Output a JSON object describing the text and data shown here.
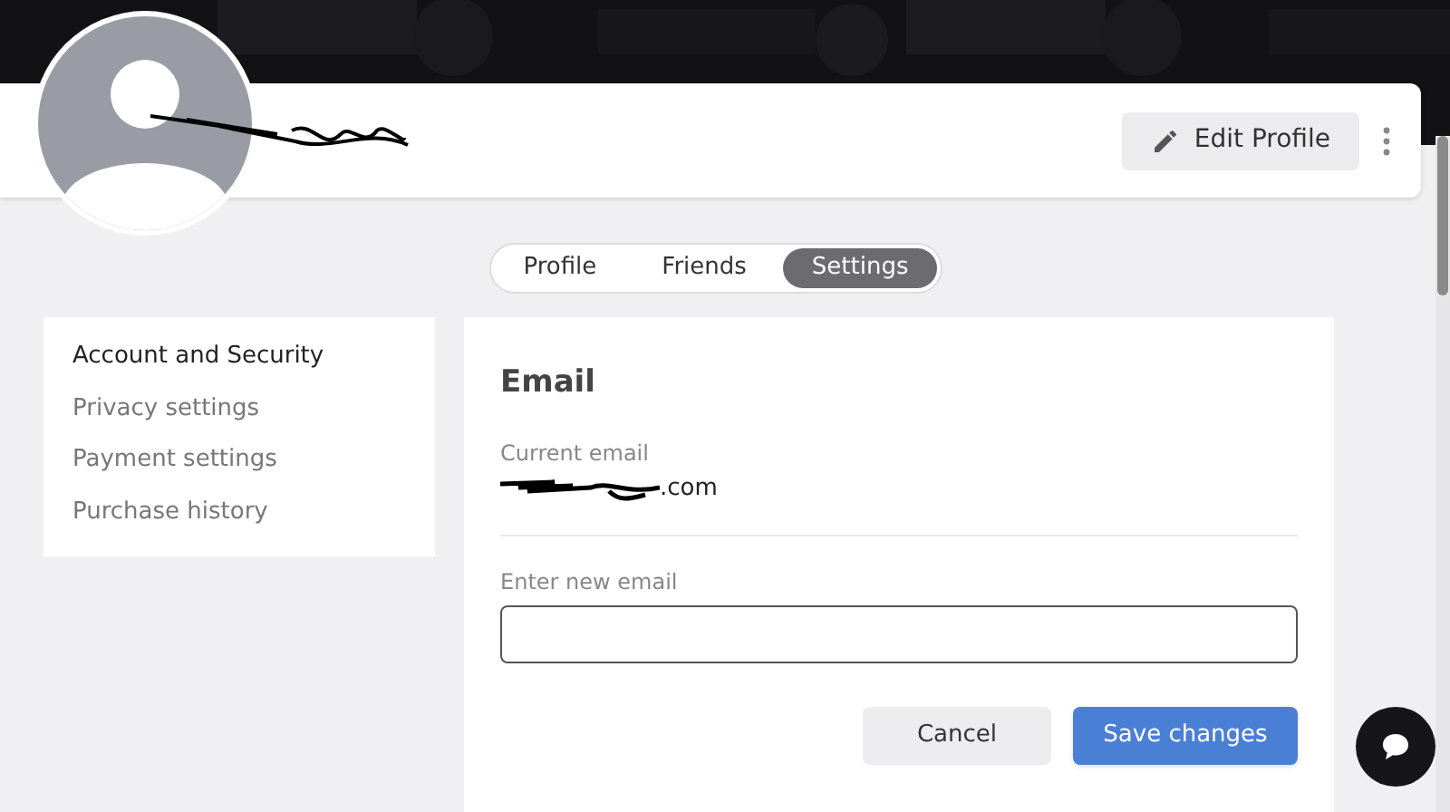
{
  "header": {
    "edit_button": "Edit Profile"
  },
  "tabs": [
    {
      "label": "Profile",
      "selected": false
    },
    {
      "label": "Friends",
      "selected": false
    },
    {
      "label": "Settings",
      "selected": true
    }
  ],
  "sidebar": {
    "items": [
      {
        "label": "Account and Security",
        "selected": true
      },
      {
        "label": "Privacy settings",
        "selected": false
      },
      {
        "label": "Payment settings",
        "selected": false
      },
      {
        "label": "Purchase history",
        "selected": false
      }
    ]
  },
  "email_panel": {
    "title": "Email",
    "current_label": "Current email",
    "current_value_visible": ".com",
    "new_label": "Enter new email",
    "cancel": "Cancel",
    "save": "Save changes"
  }
}
